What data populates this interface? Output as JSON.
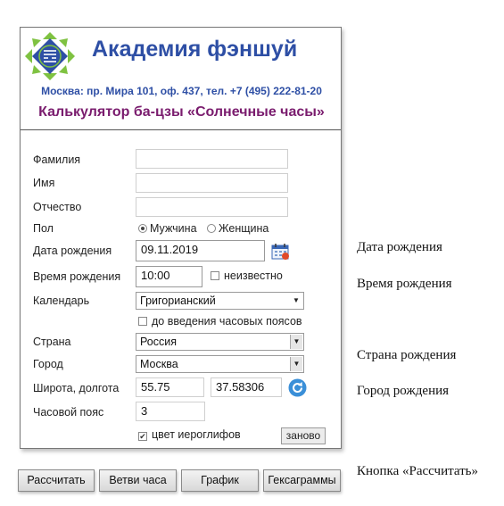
{
  "header": {
    "title": "Академия фэншуй",
    "address": "Москва: пр. Мира 101, оф. 437, тел. +7 (495) 222-81-20",
    "calculator_title": "Калькулятор ба-цзы «Солнечные часы»"
  },
  "form": {
    "surname": {
      "label": "Фамилия",
      "value": ""
    },
    "name": {
      "label": "Имя",
      "value": ""
    },
    "patronymic": {
      "label": "Отчество",
      "value": ""
    },
    "gender": {
      "label": "Пол",
      "options": [
        "Мужчина",
        "Женщина"
      ],
      "selected": "Мужчина"
    },
    "birth_date": {
      "label": "Дата рождения",
      "value": "09.11.2019"
    },
    "birth_time": {
      "label": "Время рождения",
      "value": "10:00",
      "unknown_label": "неизвестно",
      "unknown_checked": false
    },
    "calendar": {
      "label": "Календарь",
      "value": "Григорианский"
    },
    "before_timezones": {
      "label": "до введения часовых поясов",
      "checked": false
    },
    "country": {
      "label": "Страна",
      "value": "Россия"
    },
    "city": {
      "label": "Город",
      "value": "Москва"
    },
    "coords": {
      "label": "Широта, долгота",
      "latitude": "55.75",
      "longitude": "37.58306"
    },
    "timezone": {
      "label": "Часовой пояс",
      "value": "3"
    },
    "hieroglyph_color": {
      "label": "цвет иероглифов",
      "checked": true
    },
    "reset_label": "заново"
  },
  "buttons": {
    "calculate": "Рассчитать",
    "hour_branches": "Ветви часа",
    "chart": "График",
    "hexagrams": "Гексаграммы"
  },
  "annotations": {
    "birth_date": "Дата рождения",
    "birth_time": "Время рождения",
    "birth_country": "Страна рождения",
    "birth_city": "Город рождения",
    "calculate_button": "Кнопка «Рассчитать»"
  },
  "colors": {
    "title": "#2e4fa5",
    "calculator_title": "#7a1c6e",
    "logo_green": "#7fc241",
    "logo_blue": "#2e4fa5"
  }
}
